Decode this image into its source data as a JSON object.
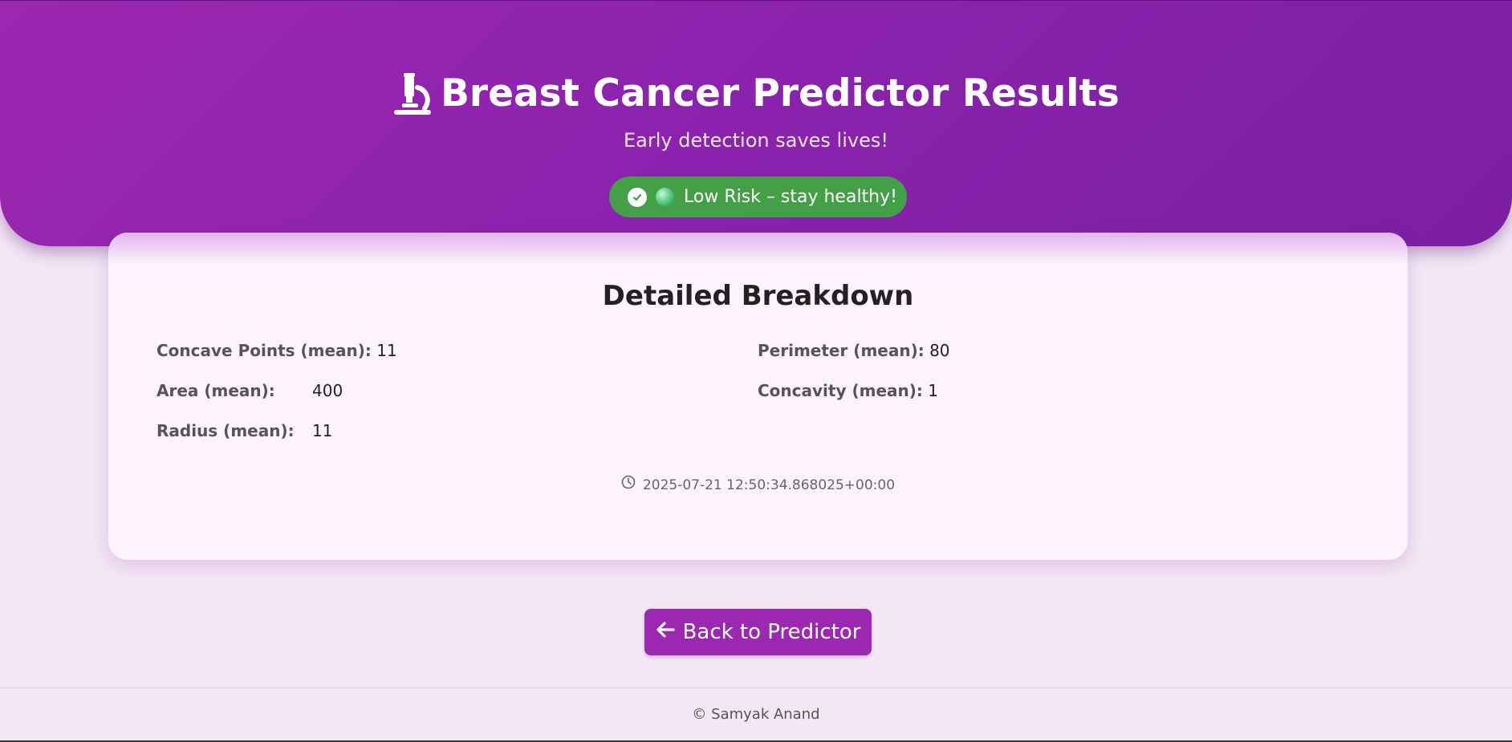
{
  "header": {
    "title": "Breast Cancer Predictor Results",
    "subtitle": "Early detection saves lives!",
    "title_icon": "microscope-icon",
    "risk_badge": {
      "text": "Low Risk – stay healthy!",
      "status_icon": "check-circle-icon",
      "indicator_icon": "green-dot-icon",
      "color": "#43a047"
    },
    "gradient_colors": [
      "#9c27b0",
      "#7b1fa2"
    ]
  },
  "breakdown": {
    "title": "Detailed Breakdown",
    "metrics": [
      {
        "label": "Concave Points (mean):",
        "value": "11"
      },
      {
        "label": "Perimeter (mean):",
        "value": "80"
      },
      {
        "label": "Area (mean):",
        "value": "400"
      },
      {
        "label": "Concavity (mean):",
        "value": "1"
      },
      {
        "label": "Radius (mean):",
        "value": "11"
      }
    ],
    "timestamp": "2025-07-21 12:50:34.868025+00:00",
    "timestamp_icon": "clock-icon"
  },
  "actions": {
    "back_label": "Back to Predictor",
    "back_icon": "arrow-left-icon",
    "button_color": "#9c27b0"
  },
  "footer": {
    "text": "© Samyak Anand"
  }
}
